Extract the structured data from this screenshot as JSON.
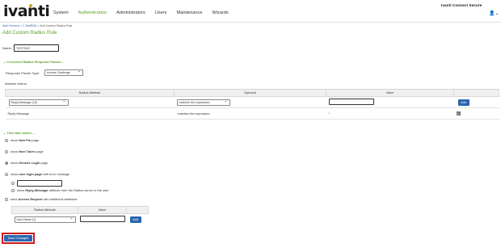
{
  "header": {
    "logo_text": "ivanti",
    "nav": [
      "System",
      "Authentication",
      "Administrators",
      "Users",
      "Maintenance",
      "Wizards"
    ],
    "active_nav": "Authentication",
    "brand": "Ivanti Connect Secure",
    "accent_color": "#5aa02c"
  },
  "breadcrumb": {
    "link1": "Auth Servers",
    "link2": "1-TestRAD",
    "current": "Add Custom Radius Rule",
    "separator": ">"
  },
  "page_title": "Add Custom Radius Rule",
  "name_field": {
    "label": "Name:",
    "value": "TESTING"
  },
  "section_received": "If received Radius Response Packet ...",
  "response_packet": {
    "label": "Response Packet Type:",
    "value": "Access Challenge"
  },
  "attribute_criteria": {
    "label": "Attribute criteria:",
    "columns": [
      "Radius Attribute",
      "Operand",
      "Value"
    ],
    "new_row": {
      "attribute": "Reply-Message (18)",
      "operand": "matches the expression",
      "value": "",
      "add_label": "Add"
    },
    "rows": [
      {
        "attribute": "Reply-Message",
        "operand": "matches the expression",
        "value": "*"
      }
    ]
  },
  "section_action": "Then take action ...",
  "actions": {
    "new_pin_pre": "show",
    "new_pin_bold": "New Pin",
    "new_pin_post": "page",
    "next_token_pre": "show",
    "next_token_bold": "Next Token",
    "next_token_post": "page",
    "generic_pre": "show",
    "generic_bold": "Generic Login",
    "generic_post": "page",
    "user_login_pre": "show",
    "user_login_bold": "user login page",
    "user_login_post": "with error message",
    "reply_msg_pre": "show",
    "reply_msg_bold": "Reply-Message",
    "reply_msg_post": "attribute from the Radius server to the user",
    "access_req_pre": "send",
    "access_req_bold": "Access Request",
    "access_req_post": "with additional attributes",
    "selected": "generic_login"
  },
  "access_request_table": {
    "columns": [
      "Radius Attribute",
      "Value"
    ],
    "attribute": "User-Name (1)",
    "value": "",
    "add_label": "Add"
  },
  "save_label": "Save Changes",
  "highlight_color": "#d01818"
}
